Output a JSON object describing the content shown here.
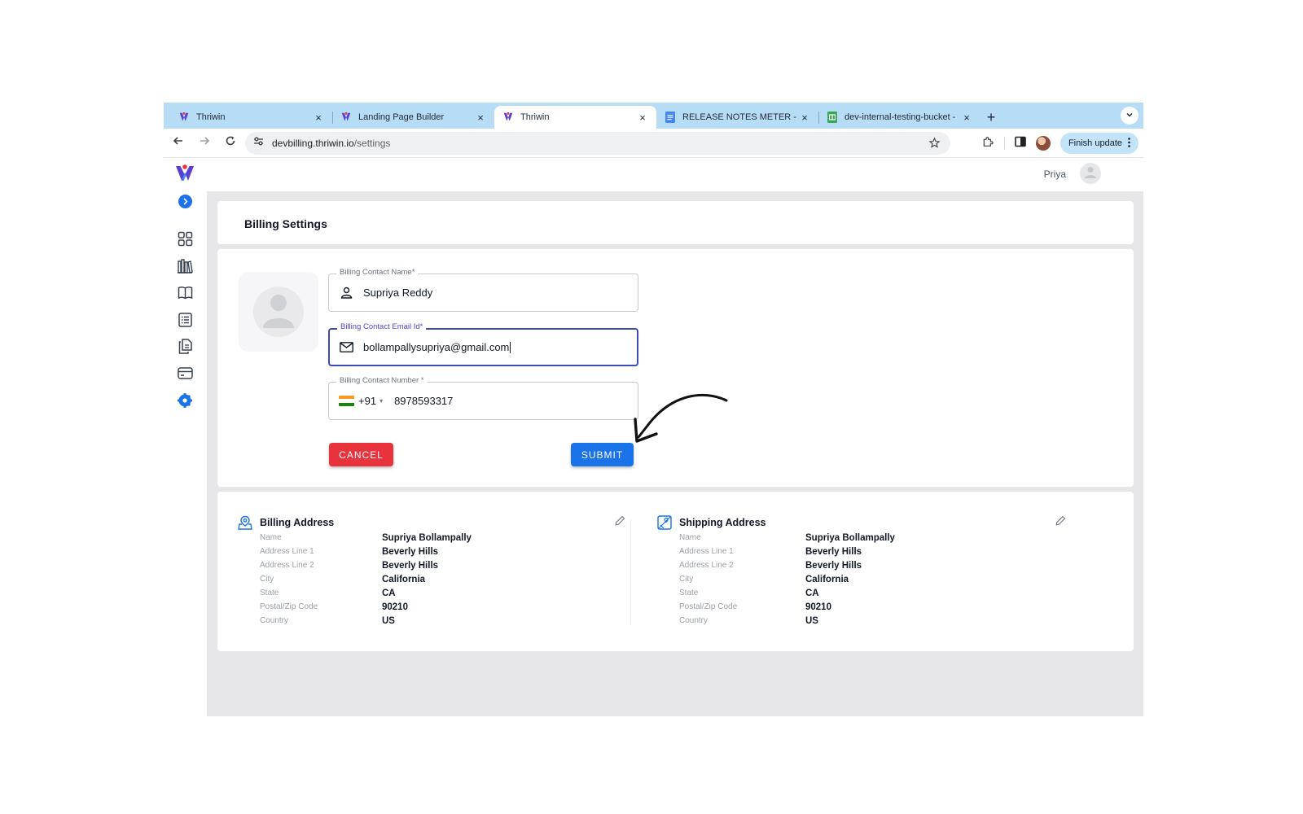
{
  "browser": {
    "tabs": [
      {
        "title": "Thriwin",
        "icon": "thriwin-logo-icon",
        "active": false
      },
      {
        "title": "Landing Page Builder",
        "icon": "thriwin-logo-icon",
        "active": false
      },
      {
        "title": "Thriwin",
        "icon": "thriwin-logo-icon",
        "active": true
      },
      {
        "title": "RELEASE NOTES METER - Go",
        "icon": "docs-icon",
        "active": false
      },
      {
        "title": "dev-internal-testing-bucket -",
        "icon": "sheets-icon",
        "active": false
      }
    ],
    "tab_close": "×",
    "new_tab": "+",
    "url_host": "devbilling.thriwin.io",
    "url_path": "/settings",
    "finish_update_label": "Finish update"
  },
  "app": {
    "user_name": "Priya",
    "page_title": "Billing Settings",
    "sidebar_icons": [
      "logo-icon",
      "expand-icon",
      "dashboard-grid-icon",
      "library-icon",
      "book-icon",
      "list-icon",
      "documents-icon",
      "card-icon",
      "settings-icon"
    ],
    "accent_color": "#1a73e8",
    "cancel_color": "#e8323c"
  },
  "form": {
    "contact_name": {
      "label": "Billing Contact Name*",
      "value": "Supriya Reddy"
    },
    "contact_email": {
      "label": "Billing Contact Email Id*",
      "value": "bollampallysupriya@gmail.com"
    },
    "contact_number": {
      "label": "Billing Contact Number *",
      "dial_code": "+91",
      "dial_arrow": "▾",
      "value": "8978593317"
    },
    "cancel_label": "CANCEL",
    "submit_label": "SUBMIT"
  },
  "billing_address": {
    "title": "Billing Address",
    "rows": [
      {
        "label": "Name",
        "value": "Supriya Bollampally"
      },
      {
        "label": "Address Line 1",
        "value": "Beverly Hills"
      },
      {
        "label": "Address Line 2",
        "value": "Beverly Hills"
      },
      {
        "label": "City",
        "value": "California"
      },
      {
        "label": "State",
        "value": "CA"
      },
      {
        "label": "Postal/Zip Code",
        "value": "90210"
      },
      {
        "label": "Country",
        "value": "US"
      }
    ]
  },
  "shipping_address": {
    "title": "Shipping Address",
    "rows": [
      {
        "label": "Name",
        "value": "Supriya Bollampally"
      },
      {
        "label": "Address Line 1",
        "value": "Beverly Hills"
      },
      {
        "label": "Address Line 2",
        "value": "Beverly Hills"
      },
      {
        "label": "City",
        "value": "California"
      },
      {
        "label": "State",
        "value": "CA"
      },
      {
        "label": "Postal/Zip Code",
        "value": "90210"
      },
      {
        "label": "Country",
        "value": "US"
      }
    ]
  }
}
